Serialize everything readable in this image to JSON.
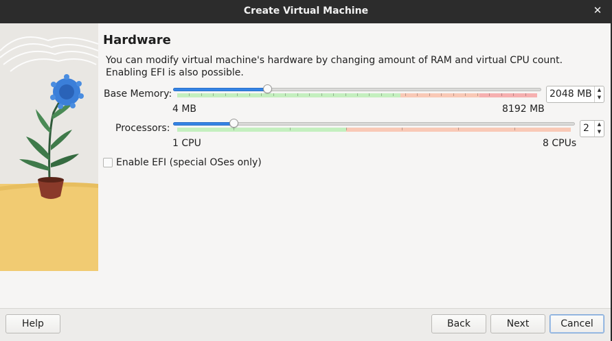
{
  "window": {
    "title": "Create Virtual Machine",
    "close_glyph": "✕"
  },
  "page": {
    "heading": "Hardware",
    "description_line1": "You can modify virtual machine's hardware by changing amount of RAM and virtual CPU count.",
    "description_line2": "Enabling EFI is also possible."
  },
  "memory": {
    "label": "Base Memory:",
    "min_label": "4 MB",
    "max_label": "8192 MB",
    "value_text": "2048 MB",
    "min": 4,
    "max": 8192,
    "value": 2048
  },
  "processors": {
    "label": "Processors:",
    "min_label": "1 CPU",
    "max_label": "8 CPUs",
    "value_text": "2",
    "min": 1,
    "max": 8,
    "value": 2
  },
  "efi": {
    "label": "Enable EFI (special OSes only)",
    "checked": false
  },
  "buttons": {
    "help": "Help",
    "back": "Back",
    "next": "Next",
    "cancel": "Cancel"
  },
  "colors": {
    "accent": "#3584e4",
    "scale_ok": "#c4efbf",
    "scale_warn": "#f9c9b6",
    "scale_bad": "#f6b0b0",
    "titlebar": "#2c2c2c",
    "art_floor": "#f1cb72"
  },
  "icons": {
    "close": "close-icon",
    "spin_up": "chevron-up-icon",
    "spin_down": "chevron-down-icon"
  }
}
